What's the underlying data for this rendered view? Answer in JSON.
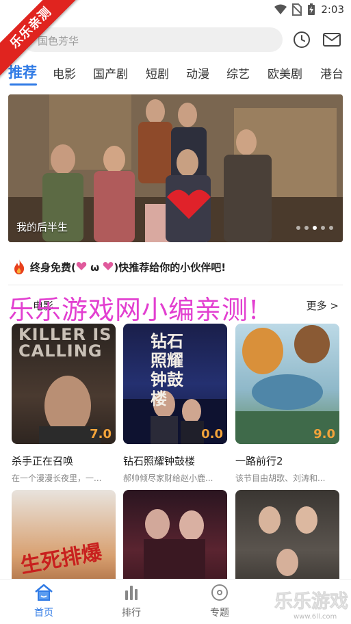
{
  "status": {
    "time": "2:03"
  },
  "ribbon": {
    "text": "乐乐亲测"
  },
  "search": {
    "placeholder": "国色芳华"
  },
  "header": {
    "history_icon": "clock-icon",
    "message_icon": "mail-icon"
  },
  "tabs": [
    {
      "label": "推荐"
    },
    {
      "label": "电影"
    },
    {
      "label": "国产剧"
    },
    {
      "label": "短剧"
    },
    {
      "label": "动漫"
    },
    {
      "label": "综艺"
    },
    {
      "label": "欧美剧"
    },
    {
      "label": "港台"
    }
  ],
  "banner": {
    "caption": "我的后半生",
    "slide_count": 5,
    "active_slide": 2
  },
  "promo": {
    "before": "终身免费(",
    "middle": " ω ",
    "after": ")快推荐给你的小伙伴吧!"
  },
  "section": {
    "title": "电影",
    "more": "更多 >"
  },
  "watermark": "乐乐游戏网小编亲测!",
  "cards": [
    {
      "title": "杀手正在召唤",
      "desc": "在一个漫漫长夜里，一...",
      "score": "7.0",
      "poster_text": "KILLER IS CALLING"
    },
    {
      "title": "钻石照耀钟鼓楼",
      "desc": "郝帅倾尽家财给赵小鹿...",
      "score": "0.0",
      "poster_text": "钻石照耀钟鼓楼"
    },
    {
      "title": "一路前行2",
      "desc": "该节目由胡歌、刘涛和...",
      "score": "9.0",
      "poster_text": ""
    },
    {
      "poster_text": "生死排爆"
    },
    {
      "poster_text": ""
    },
    {
      "poster_text": ""
    }
  ],
  "nav": [
    {
      "label": "首页",
      "icon": "home-icon",
      "active": true
    },
    {
      "label": "排行",
      "icon": "ranking-icon"
    },
    {
      "label": "专题",
      "icon": "disc-icon"
    }
  ],
  "corner_logo": {
    "text": "乐乐游戏",
    "url_text": "www.6ll.com"
  },
  "colors": {
    "accent": "#2f7ae5",
    "ribbon": "#e0241f",
    "watermark": "#e23fd0",
    "score": "#f2a33a"
  }
}
